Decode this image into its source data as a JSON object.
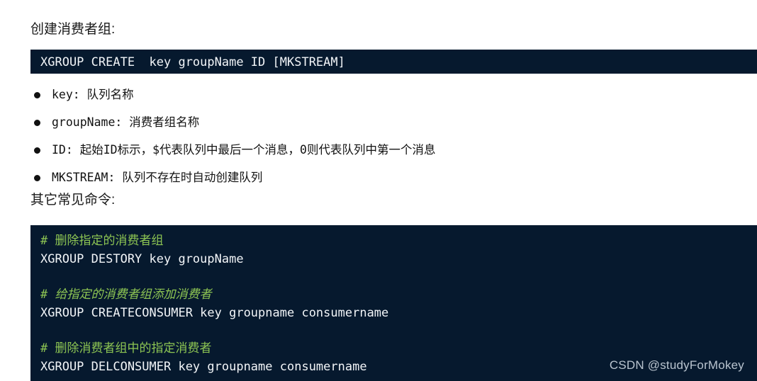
{
  "colors": {
    "page_background": "#ffffff",
    "code_background": "#06192e",
    "code_text": "#f2f5f8",
    "comment_green": "#8dc553",
    "body_text": "#1a1a1a",
    "watermark_text": "#b9c4cf"
  },
  "sections": {
    "create_group_label": "创建消费者组:",
    "other_commands_label": "其它常见命令:"
  },
  "create_command": {
    "line": "XGROUP CREATE  key groupName ID [MKSTREAM]"
  },
  "parameters": [
    {
      "name": "key",
      "text": "key: 队列名称"
    },
    {
      "name": "groupName",
      "text": "groupName: 消费者组名称"
    },
    {
      "name": "ID",
      "text": "ID: 起始ID标示，$代表队列中最后一个消息，0则代表队列中第一个消息"
    },
    {
      "name": "MKSTREAM",
      "text": "MKSTREAM: 队列不存在时自动创建队列"
    }
  ],
  "other_commands": [
    {
      "type": "comment",
      "italic": false,
      "text": "# 删除指定的消费者组"
    },
    {
      "type": "command",
      "italic": false,
      "text": "XGROUP DESTORY key groupName"
    },
    {
      "type": "blank",
      "italic": false,
      "text": " "
    },
    {
      "type": "comment",
      "italic": true,
      "text": "# 给指定的消费者组添加消费者"
    },
    {
      "type": "command",
      "italic": false,
      "text": "XGROUP CREATECONSUMER key groupname consumername"
    },
    {
      "type": "blank",
      "italic": false,
      "text": " "
    },
    {
      "type": "comment",
      "italic": false,
      "text": "# 删除消费者组中的指定消费者"
    },
    {
      "type": "command",
      "italic": false,
      "text": "XGROUP DELCONSUMER key groupname consumername"
    }
  ],
  "watermark": {
    "text": "CSDN @studyForMokey"
  }
}
